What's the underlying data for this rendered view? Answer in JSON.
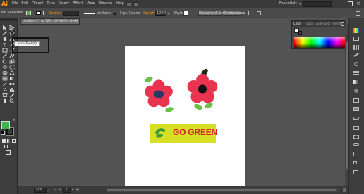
{
  "app": {
    "logo": "Ai",
    "menu": [
      "File",
      "Edit",
      "Object",
      "Type",
      "Select",
      "Effect",
      "View",
      "Window",
      "Help"
    ],
    "workspace": "Essentials"
  },
  "control_bar": {
    "selection": "No Selection",
    "stroke_label": "Stroke:",
    "profile": "Uniform",
    "brush": "5 pt. Round",
    "opacity_label": "Opacity:",
    "opacity_value": "100%",
    "style_label": "Style:",
    "document_setup": "Document Setup",
    "preferences": "Preferences"
  },
  "document_tab": {
    "title": "Untitled-2* @ 72% (CMYK/Preview)",
    "close": "×"
  },
  "tooltip": {
    "text": "Lasso Tool (Q)"
  },
  "color_panel": {
    "tabs": [
      "Color",
      "Color Guide",
      "Color Themes"
    ],
    "colors": {
      "fill": "#ffffff",
      "stroke": "#111111",
      "spectrum_start": "#ff0000"
    }
  },
  "artwork": {
    "badge_text": "GO GREEN",
    "colors": {
      "petal": "#e8344e",
      "center": "#2b3566",
      "leaf": "#6cc04a",
      "badge": "#d6df23",
      "badge_text": "#d2232a"
    }
  },
  "status_bar": {
    "zoom": "72%",
    "page": "1"
  },
  "tools": {
    "fill_color": "#3cb54a",
    "stroke_color": "#111111"
  },
  "colors": {
    "ui_bg": "#535353",
    "panel": "#3d3d3d",
    "menubar": "#3a3a3a",
    "control": "#4a4a4a",
    "accent": "#ff9a00"
  }
}
